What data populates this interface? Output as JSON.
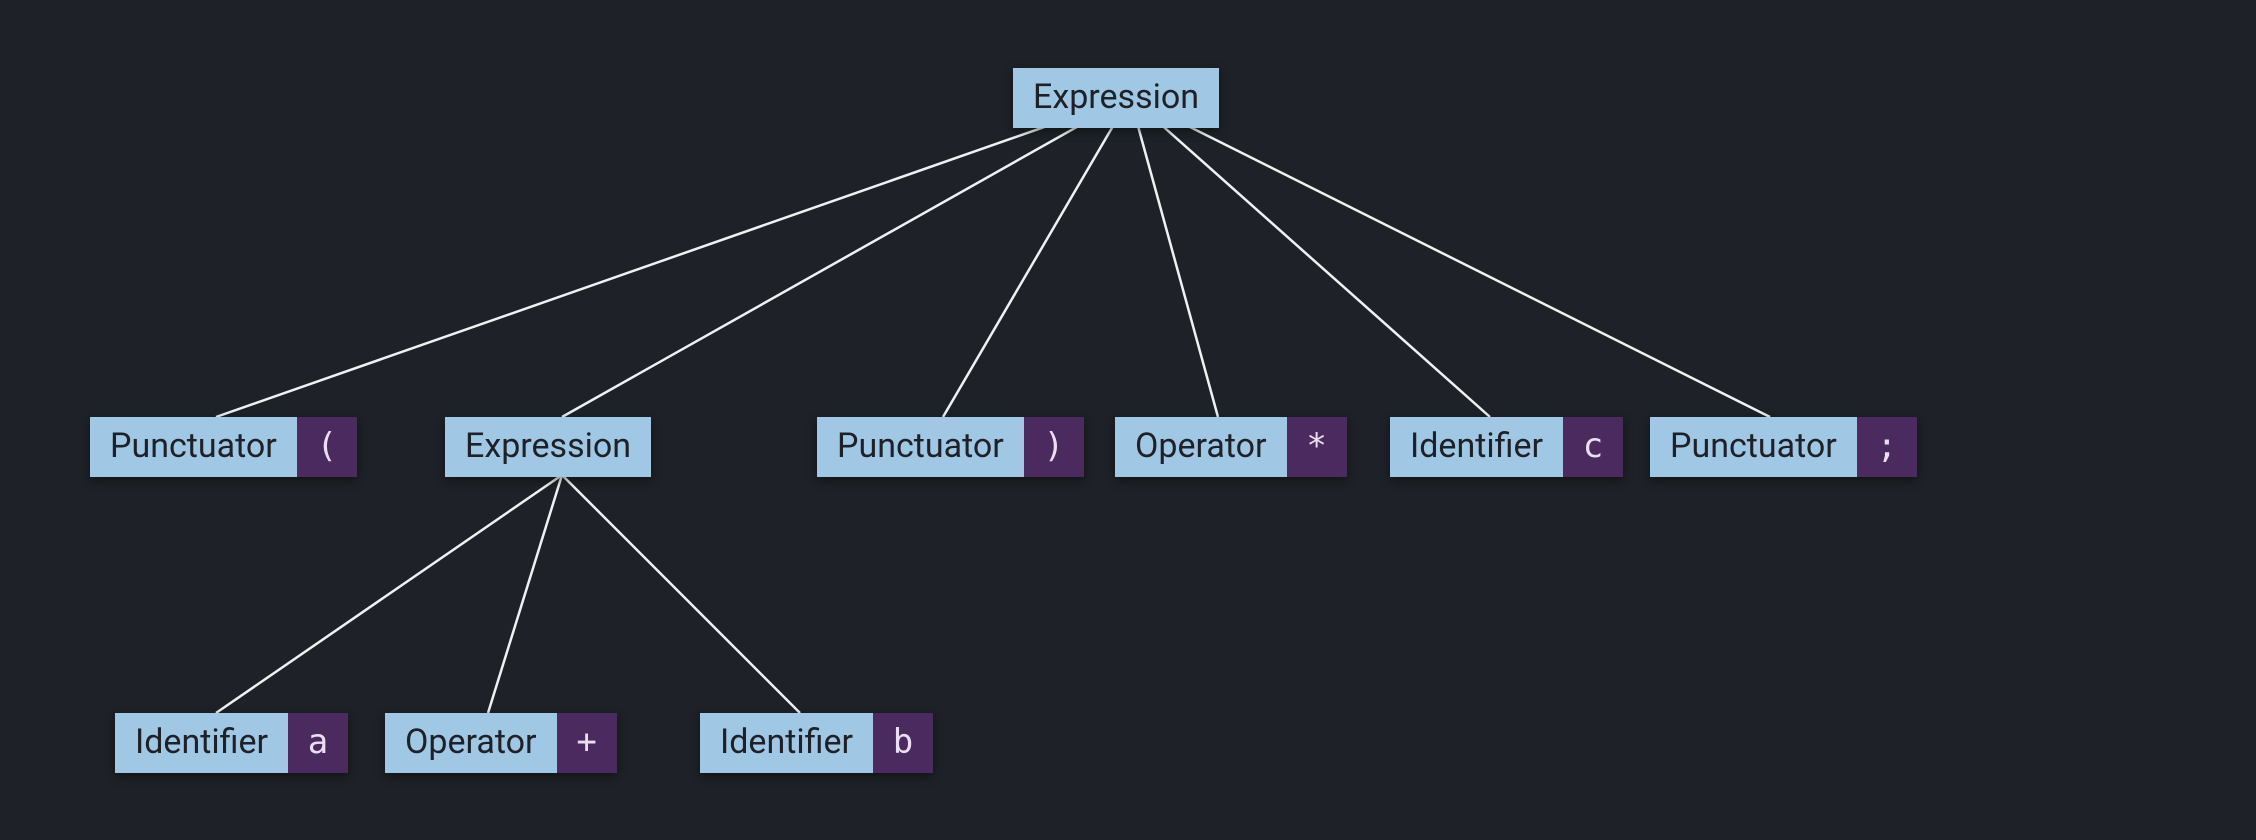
{
  "colors": {
    "background": "#1e2127",
    "node_type_bg": "#a0c7e4",
    "node_type_fg": "#1e2127",
    "node_value_bg": "#4b2a60",
    "node_value_fg": "#e9dff1",
    "edge_stroke": "#f0f1f2"
  },
  "root": {
    "type": "Expression"
  },
  "level2": {
    "punct_open": {
      "type": "Punctuator",
      "value": "("
    },
    "expr": {
      "type": "Expression"
    },
    "punct_close": {
      "type": "Punctuator",
      "value": ")"
    },
    "operator": {
      "type": "Operator",
      "value": "*"
    },
    "identifier": {
      "type": "Identifier",
      "value": "c"
    },
    "punct_semi": {
      "type": "Punctuator",
      "value": ";"
    }
  },
  "level3": {
    "ident_a": {
      "type": "Identifier",
      "value": "a"
    },
    "operator": {
      "type": "Operator",
      "value": "+"
    },
    "ident_b": {
      "type": "Identifier",
      "value": "b"
    }
  }
}
